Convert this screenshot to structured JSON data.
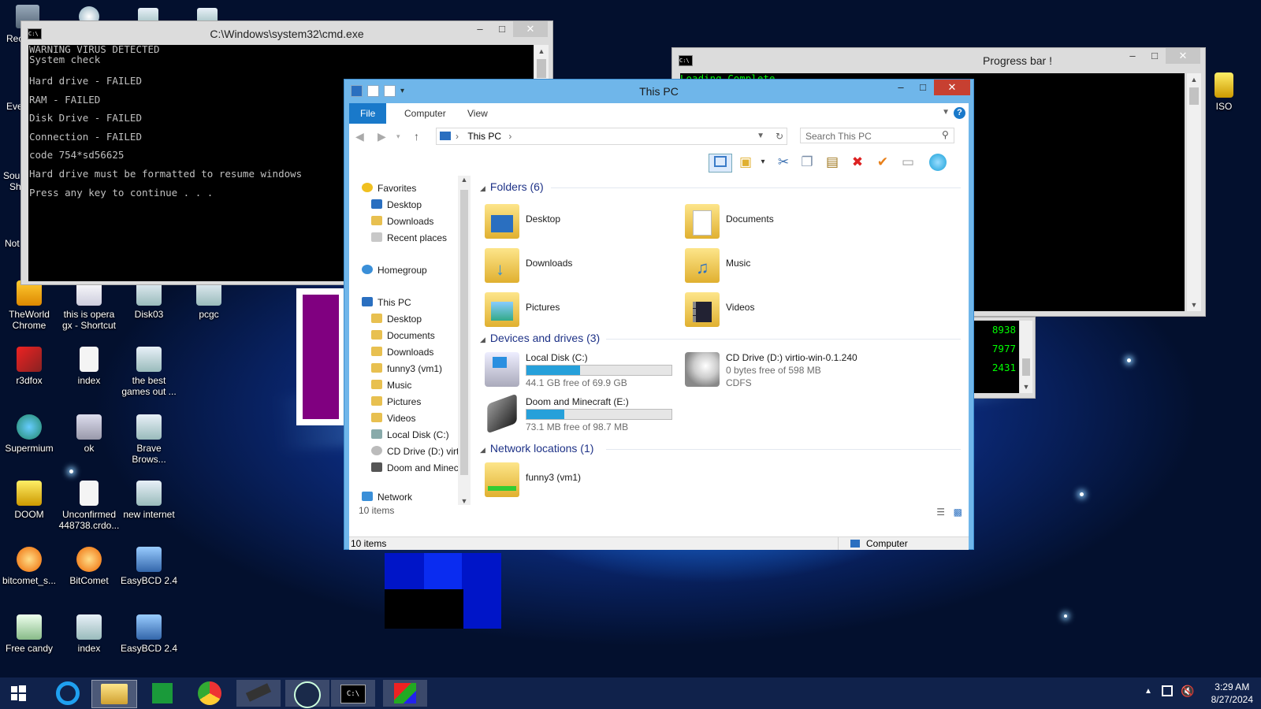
{
  "desktop": {
    "icons": [
      {
        "label": "TheWorld Chrome"
      },
      {
        "label": "this is opera gx - Shortcut"
      },
      {
        "label": "Disk03"
      },
      {
        "label": "pcgc"
      },
      {
        "label": "r3dfox"
      },
      {
        "label": "index"
      },
      {
        "label": "the best games out ..."
      },
      {
        "label": "Supermium"
      },
      {
        "label": "ok"
      },
      {
        "label": "Brave Brows..."
      },
      {
        "label": "DOOM"
      },
      {
        "label": "Unconfirmed 448738.crdo..."
      },
      {
        "label": "new internet"
      },
      {
        "label": "bitcomet_s..."
      },
      {
        "label": "BitComet"
      },
      {
        "label": "EasyBCD 2.4"
      },
      {
        "label": "Free candy"
      },
      {
        "label": "index"
      },
      {
        "label": "EasyBCD 2.4"
      },
      {
        "label": "ISO"
      }
    ],
    "partial": [
      "Rec",
      "Eve",
      "Sou",
      "Sh",
      "Not"
    ]
  },
  "cmd": {
    "title": "C:\\Windows\\system32\\cmd.exe",
    "lines": [
      "WARNING VIRUS DETECTED",
      "System check",
      "Hard drive - FAILED",
      "RAM - FAILED",
      "Disk Drive - FAILED",
      "Connection - FAILED",
      "code 754*sd56625",
      "Hard drive must be formatted to resume windows",
      "Press any key to continue . . ."
    ]
  },
  "progress": {
    "title": "Progress bar !",
    "line": "Loading Complete...",
    "numbers": [
      "8938",
      "7977",
      "2431"
    ]
  },
  "explorer": {
    "title": "This PC",
    "tabs": {
      "file": "File",
      "computer": "Computer",
      "view": "View"
    },
    "address": "This PC",
    "search_placeholder": "Search This PC",
    "nav": {
      "favorites": "Favorites",
      "desktop": "Desktop",
      "downloads": "Downloads",
      "recent": "Recent places",
      "homegroup": "Homegroup",
      "thispc": "This PC",
      "pc_desktop": "Desktop",
      "pc_documents": "Documents",
      "pc_downloads": "Downloads",
      "pc_funny": "funny3 (vm1)",
      "pc_music": "Music",
      "pc_pictures": "Pictures",
      "pc_videos": "Videos",
      "pc_c": "Local Disk (C:)",
      "pc_d": "CD Drive (D:) virt",
      "pc_e": "Doom and Minec",
      "network": "Network"
    },
    "groups": {
      "folders": "Folders (6)",
      "drives": "Devices and drives (3)",
      "network": "Network locations (1)"
    },
    "folders": [
      {
        "name": "Desktop"
      },
      {
        "name": "Documents"
      },
      {
        "name": "Downloads"
      },
      {
        "name": "Music"
      },
      {
        "name": "Pictures"
      },
      {
        "name": "Videos"
      }
    ],
    "drives": [
      {
        "name": "Local Disk (C:)",
        "free": "44.1 GB free of 69.9 GB",
        "used_fraction": 0.37
      },
      {
        "name": "CD Drive (D:) virtio-win-0.1.240",
        "free": "0 bytes free of 598 MB",
        "fs": "CDFS"
      },
      {
        "name": "Doom and Minecraft (E:)",
        "free": "73.1 MB free of 98.7 MB",
        "used_fraction": 0.26
      }
    ],
    "network_item": "funny3 (vm1)",
    "item_count": "10 items",
    "status_items": "10 items",
    "status_computer": "Computer"
  },
  "taskbar": {
    "time": "3:29 AM",
    "date": "8/27/2024"
  },
  "colors": {
    "accent": "#1979ca",
    "progress": "#26a0da",
    "title_active": "#6fb6ea",
    "close": "#c74031"
  }
}
